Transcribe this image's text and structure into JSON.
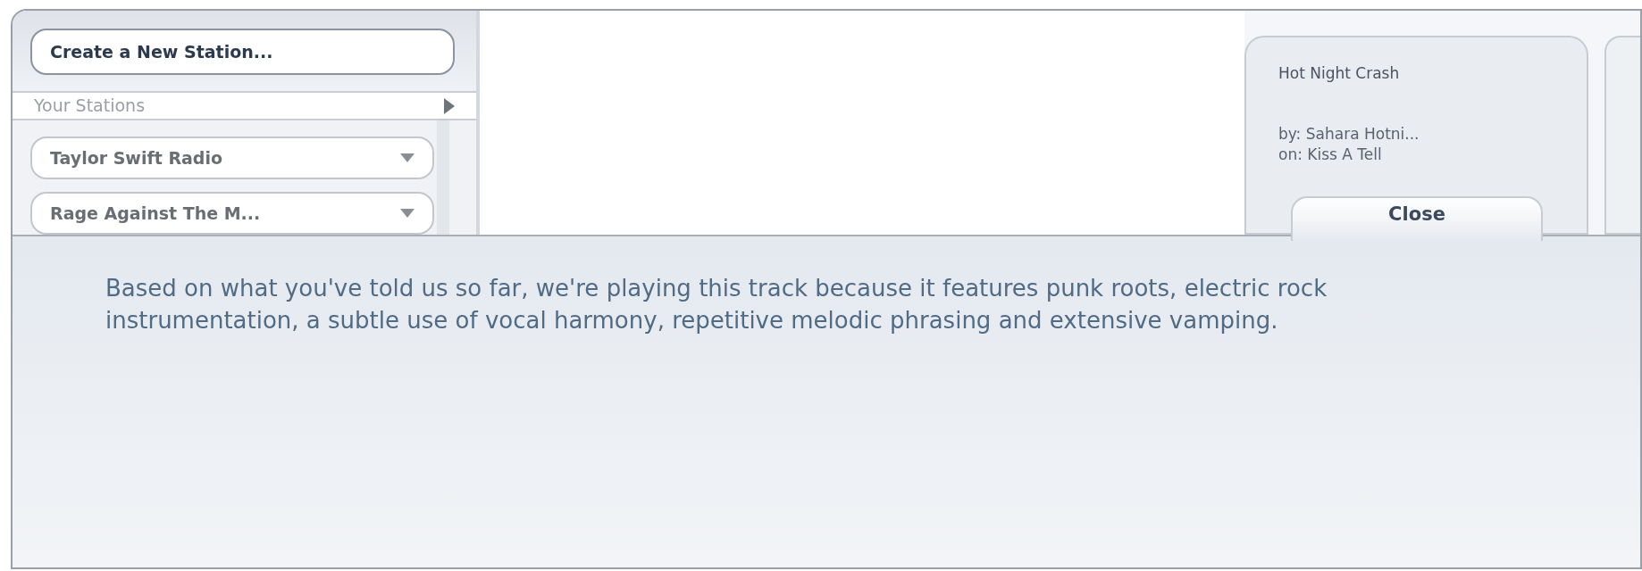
{
  "sidebar": {
    "create_button": "Create a New Station...",
    "section_title": "Your Stations",
    "stations": [
      {
        "label": "Taylor Swift Radio"
      },
      {
        "label": "Rage Against The M..."
      }
    ]
  },
  "track": {
    "title": "Hot Night Crash",
    "artist": "by: Sahara Hotni...",
    "album": "on: Kiss A Tell",
    "close_button": "Close"
  },
  "explanation": "Based on what you've told us so far, we're playing this track because it features punk roots, electric rock instrumentation, a subtle use of vocal harmony, repetitive melodic phrasing and extensive vamping."
}
